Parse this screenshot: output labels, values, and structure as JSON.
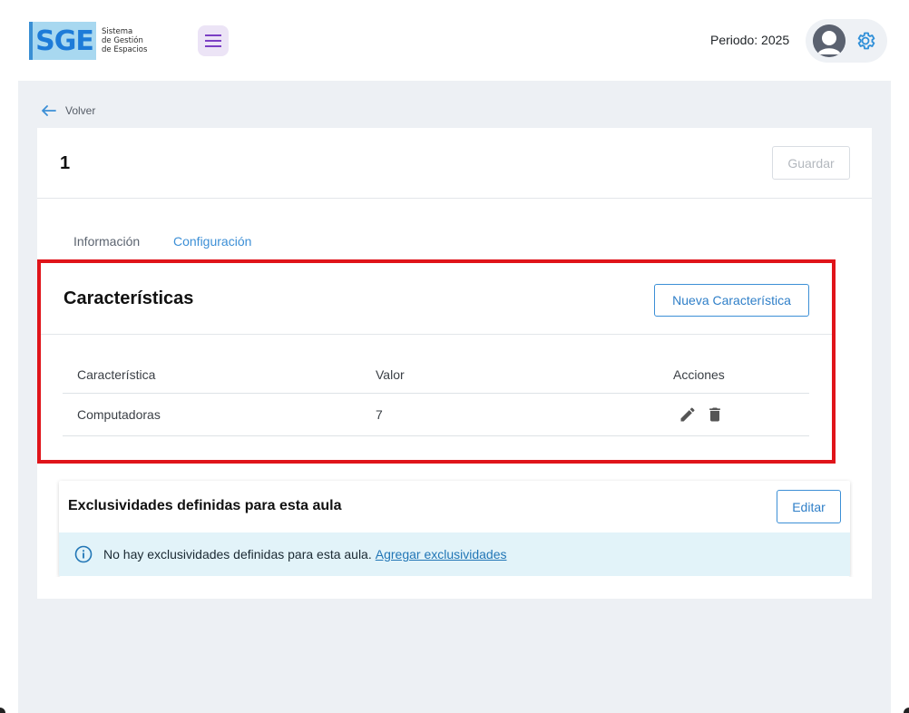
{
  "header": {
    "logo_mark": "SGE",
    "logo_lines": [
      "Sistema",
      "de Gestión",
      "de Espacios"
    ],
    "periodo_label": "Periodo: 2025",
    "icons": {
      "menu": "hamburger-icon",
      "user": "user-avatar-icon",
      "settings": "gear-icon"
    },
    "accent": "#3c8fd6"
  },
  "nav": {
    "back_label": "Volver"
  },
  "record": {
    "title": "1",
    "save_label": "Guardar"
  },
  "tabs": [
    {
      "label": "Información",
      "active": false
    },
    {
      "label": "Configuración",
      "active": true
    }
  ],
  "caracteristicas": {
    "title": "Características",
    "new_button": "Nueva Característica",
    "columns": [
      "Característica",
      "Valor",
      "Acciones"
    ],
    "rows": [
      {
        "caracteristica": "Computadoras",
        "valor": "7",
        "actions": [
          "edit-icon",
          "delete-icon"
        ]
      }
    ],
    "highlight_color": "#e0141a"
  },
  "exclusividades": {
    "title": "Exclusividades definidas para esta aula",
    "edit_button": "Editar",
    "alert_text": "No hay exclusividades definidas para esta aula.",
    "alert_link": "Agregar exclusividades"
  }
}
